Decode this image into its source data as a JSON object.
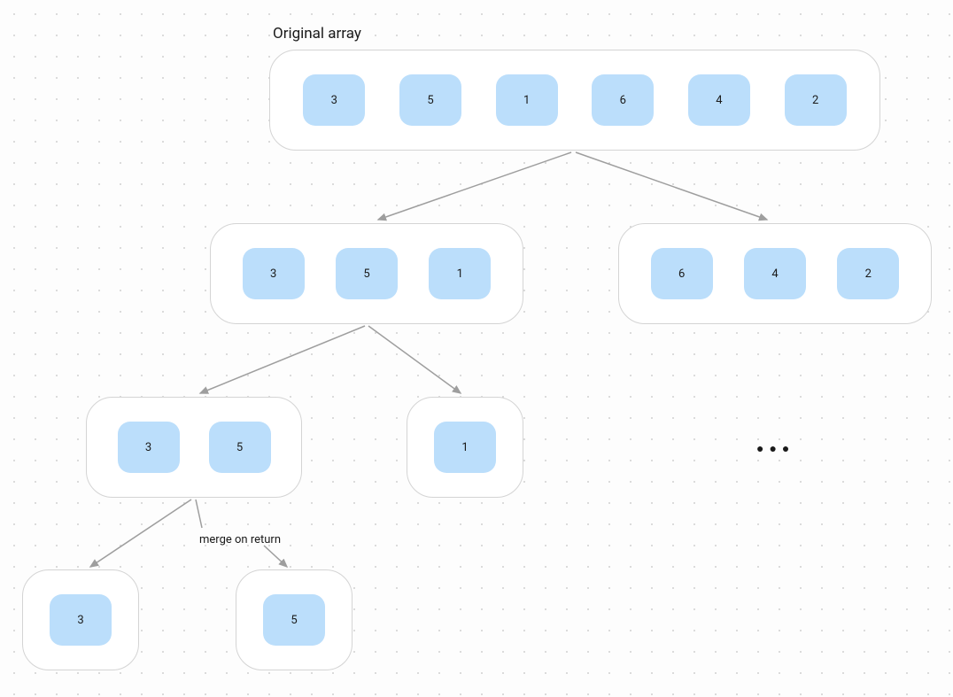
{
  "title": "Original array",
  "merge_label": "merge on return",
  "ellipsis": "●●●",
  "nodes": {
    "root": {
      "values": [
        "3",
        "5",
        "1",
        "6",
        "4",
        "2"
      ]
    },
    "left1": {
      "values": [
        "3",
        "5",
        "1"
      ]
    },
    "right1": {
      "values": [
        "6",
        "4",
        "2"
      ]
    },
    "left2": {
      "values": [
        "3",
        "5"
      ]
    },
    "right2": {
      "values": [
        "1"
      ]
    },
    "left3": {
      "values": [
        "3"
      ]
    },
    "right3": {
      "values": [
        "5"
      ]
    }
  }
}
